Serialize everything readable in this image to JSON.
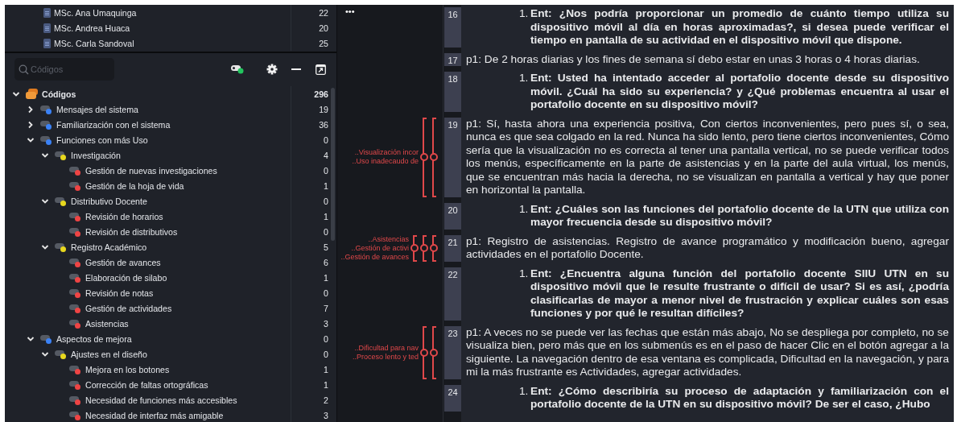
{
  "documents": [
    {
      "name": "MSc. Ana Umaquinga",
      "count": "22"
    },
    {
      "name": "MSc. Andrea Huaca",
      "count": "20"
    },
    {
      "name": "MSc. Carla Sandoval",
      "count": "25"
    }
  ],
  "codes_panel": {
    "search": {
      "placeholder": "Códigos"
    },
    "tree": [
      {
        "name": "Códigos",
        "count": "296",
        "kind": "root",
        "expanded": true,
        "children": [
          {
            "name": "Mensajes del sistema",
            "count": "19",
            "color": "#3b82f6",
            "expanded": false
          },
          {
            "name": "Familiarización con el sistema",
            "count": "36",
            "color": "#3b82f6",
            "expanded": false
          },
          {
            "name": "Funciones con más Uso",
            "count": "0",
            "color": "#3b82f6",
            "expanded": true,
            "children": [
              {
                "name": "Investigación",
                "count": "4",
                "color": "#e8d81e",
                "expanded": true,
                "children": [
                  {
                    "name": "Gestión de nuevas investigaciones",
                    "count": "0",
                    "color": "#ef4444"
                  },
                  {
                    "name": "Gestión de la hoja de vida",
                    "count": "1",
                    "color": "#ef4444"
                  }
                ]
              },
              {
                "name": "Distributivo Docente",
                "count": "0",
                "color": "#e8d81e",
                "expanded": true,
                "children": [
                  {
                    "name": "Revisión de horarios",
                    "count": "1",
                    "color": "#ef4444"
                  },
                  {
                    "name": "Revisión de distributivos",
                    "count": "0",
                    "color": "#ef4444"
                  }
                ]
              },
              {
                "name": "Registro Académico",
                "count": "5",
                "color": "#e8d81e",
                "expanded": true,
                "children": [
                  {
                    "name": "Gestión de avances",
                    "count": "6",
                    "color": "#ef4444"
                  },
                  {
                    "name": "Elaboración de silabo",
                    "count": "1",
                    "color": "#ef4444"
                  },
                  {
                    "name": "Revisión de notas",
                    "count": "0",
                    "color": "#ef4444"
                  },
                  {
                    "name": "Gestión de actividades",
                    "count": "7",
                    "color": "#ef4444"
                  },
                  {
                    "name": "Asistencias",
                    "count": "3",
                    "color": "#ef4444"
                  }
                ]
              }
            ]
          },
          {
            "name": "Aspectos de mejora",
            "count": "0",
            "color": "#3b82f6",
            "expanded": true,
            "children": [
              {
                "name": "Ajustes en el diseño",
                "count": "0",
                "color": "#e8d81e",
                "expanded": true,
                "children": [
                  {
                    "name": "Mejora en los botones",
                    "count": "1",
                    "color": "#ef4444"
                  },
                  {
                    "name": "Corrección de faltas ortográficas",
                    "count": "1",
                    "color": "#ef4444"
                  },
                  {
                    "name": "Necesidad de funciones más accesibles",
                    "count": "2",
                    "color": "#ef4444"
                  },
                  {
                    "name": "Necesidad de interfaz más amigable",
                    "count": "3",
                    "color": "#ef4444"
                  }
                ]
              }
            ]
          }
        ]
      }
    ]
  },
  "document": {
    "menu": "•••",
    "paragraphs": [
      {
        "number": "16",
        "kind": "question",
        "marker": "1.",
        "text": "Ent: ¿Nos podría proporcionar un promedio de cuánto tiempo utiliza su dispositivo móvil al día en horas aproximadas?, si desea puede verificar el tiempo en pantalla de su actividad en el dispositivo móvil que dispone."
      },
      {
        "number": "17",
        "kind": "answer",
        "text": "p1: De 2 horas diarias y los fines de semana sí debo estar en unas 3 horas o 4 horas diarias."
      },
      {
        "number": "18",
        "kind": "question",
        "marker": "1.",
        "text": "Ent: Usted ha intentado acceder al portafolio docente desde su dispositivo móvil. ¿Cuál ha sido su experiencia? y ¿Qué problemas encuentra al usar el portafolio docente en su dispositivo móvil?"
      },
      {
        "number": "19",
        "kind": "answer",
        "text": "p1: Sí, hasta ahora una experiencia positiva, Con ciertos inconvenientes, pero pues sí, o sea, nunca es que sea colgado en la red. Nunca ha sido lento, pero tiene ciertos inconvenientes, Cómo sería que la visualización no es correcta al tener una pantalla vertical, no se puede verificar todos los menús, específicamente en la parte de asistencias y en la parte del aula virtual, los menús, que se encuentran más hacia la derecha, no se visualizan en pantalla a vertical y hay que poner en horizontal la pantalla.",
        "codes": [
          "..Visualización incor",
          "..Uso inadecaudo de"
        ]
      },
      {
        "number": "20",
        "kind": "question",
        "marker": "1.",
        "text": "Ent: ¿Cuáles son las funciones del portafolio docente de la UTN que utiliza con mayor frecuencia desde su dispositivo móvil?"
      },
      {
        "number": "21",
        "kind": "answer",
        "text": "p1: Registro de asistencias. Registro de avance programático y modificación bueno, agregar actividades en el portafolio Docente.",
        "codes": [
          "..Asistencias",
          "..Gestión de activi",
          "..Gestión de avances"
        ]
      },
      {
        "number": "22",
        "kind": "question",
        "marker": "1.",
        "text": "Ent: ¿Encuentra alguna función del portafolio docente SIIU UTN en su dispositivo móvil que le resulte frustrante o difícil de usar? Si es así, ¿podría clasificarlas de mayor a menor nivel de frustración y explicar cuáles son esas funciones y por qué le resultan difíciles?"
      },
      {
        "number": "23",
        "kind": "answer",
        "text": "p1: A veces no se puede ver las fechas que están más abajo, No se despliega por completo, no se visualiza bien, pero más que en los submenús es en el paso de hacer Clic en el botón agregar a la siguiente. La navegación dentro de esa ventana es complicada, Dificultad en la navegación, y para mi la más frustrante es Actividades, agregar actividades.",
        "codes": [
          "..Dificultad para nav",
          "..Proceso lento y ted"
        ]
      },
      {
        "number": "24",
        "kind": "question",
        "marker": "1.",
        "text": "Ent: ¿Cómo describiría su proceso de adaptación y familiarización con el portafolio docente de la UTN en su dispositivo móvil? De ser el caso, ¿Hubo"
      }
    ]
  }
}
